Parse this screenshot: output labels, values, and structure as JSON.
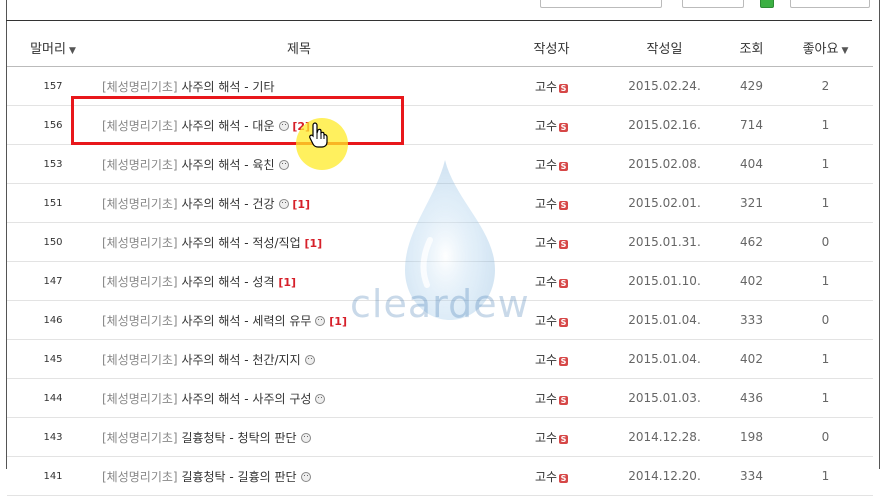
{
  "header": {
    "col_prefix": "말머리",
    "col_title": "제목",
    "col_author": "작성자",
    "col_date": "작성일",
    "col_views": "조회",
    "col_likes": "좋아요"
  },
  "watermark": "cleardew",
  "rows": [
    {
      "no": "157",
      "category": "[체성명리기초]",
      "title": "사주의 해석 - 기타",
      "smile": false,
      "comments": "",
      "author": "고수",
      "badge": "S",
      "date": "2015.02.24.",
      "views": "429",
      "likes": "2"
    },
    {
      "no": "156",
      "category": "[체성명리기초]",
      "title": "사주의 해석 - 대운",
      "smile": true,
      "comments": "[2]",
      "author": "고수",
      "badge": "S",
      "date": "2015.02.16.",
      "views": "714",
      "likes": "1"
    },
    {
      "no": "153",
      "category": "[체성명리기초]",
      "title": "사주의 해석 - 육친",
      "smile": true,
      "comments": "",
      "author": "고수",
      "badge": "S",
      "date": "2015.02.08.",
      "views": "404",
      "likes": "1"
    },
    {
      "no": "151",
      "category": "[체성명리기초]",
      "title": "사주의 해석 - 건강",
      "smile": true,
      "comments": "[1]",
      "author": "고수",
      "badge": "S",
      "date": "2015.02.01.",
      "views": "321",
      "likes": "1"
    },
    {
      "no": "150",
      "category": "[체성명리기초]",
      "title": "사주의 해석 - 적성/직업",
      "smile": false,
      "comments": "[1]",
      "author": "고수",
      "badge": "S",
      "date": "2015.01.31.",
      "views": "462",
      "likes": "0"
    },
    {
      "no": "147",
      "category": "[체성명리기초]",
      "title": "사주의 해석 - 성격",
      "smile": false,
      "comments": "[1]",
      "author": "고수",
      "badge": "S",
      "date": "2015.01.10.",
      "views": "402",
      "likes": "1"
    },
    {
      "no": "146",
      "category": "[체성명리기초]",
      "title": "사주의 해석 - 세력의 유무",
      "smile": true,
      "comments": "[1]",
      "author": "고수",
      "badge": "S",
      "date": "2015.01.04.",
      "views": "333",
      "likes": "0"
    },
    {
      "no": "145",
      "category": "[체성명리기초]",
      "title": "사주의 해석 - 천간/지지",
      "smile": true,
      "comments": "",
      "author": "고수",
      "badge": "S",
      "date": "2015.01.04.",
      "views": "402",
      "likes": "1"
    },
    {
      "no": "144",
      "category": "[체성명리기초]",
      "title": "사주의 해석 - 사주의 구성",
      "smile": true,
      "comments": "",
      "author": "고수",
      "badge": "S",
      "date": "2015.01.03.",
      "views": "436",
      "likes": "1"
    },
    {
      "no": "143",
      "category": "[체성명리기초]",
      "title": "길흉청탁 - 청탁의 판단",
      "smile": true,
      "comments": "",
      "author": "고수",
      "badge": "S",
      "date": "2014.12.28.",
      "views": "198",
      "likes": "0"
    },
    {
      "no": "141",
      "category": "[체성명리기초]",
      "title": "길흉청탁 - 길흉의 판단",
      "smile": true,
      "comments": "",
      "author": "고수",
      "badge": "S",
      "date": "2014.12.20.",
      "views": "334",
      "likes": "1"
    }
  ]
}
